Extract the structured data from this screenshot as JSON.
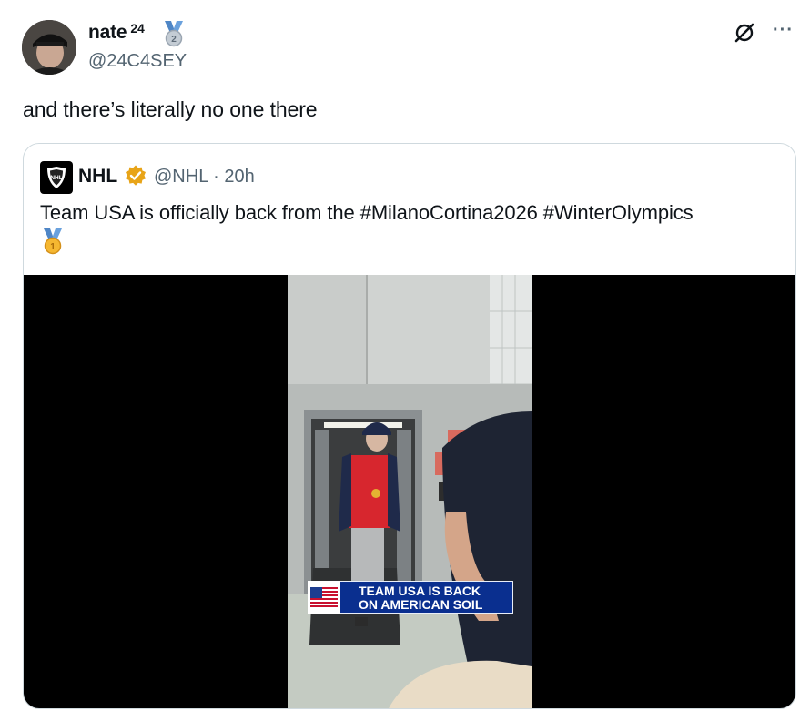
{
  "author": {
    "name": "nate",
    "superscript": "24",
    "handle": "@24C4SEY",
    "badge_icon": "silver-medal-icon"
  },
  "tweet": {
    "text": "and there’s literally no one there"
  },
  "quoted": {
    "name": "NHL",
    "handle_time": "@NHL · 20h",
    "verified_color": "#e8a418",
    "text": "Team USA is officially back from the #MilanoCortina2026 #WinterOlympics",
    "medal_icon": "gold-medal-icon",
    "video": {
      "banner_line1": "TEAM USA IS BACK",
      "banner_line2": "ON AMERICAN SOIL",
      "banner_color": "#0a2f8f"
    }
  },
  "colors": {
    "text": "#0f1419",
    "secondary": "#536471",
    "border": "#cfd9de"
  }
}
